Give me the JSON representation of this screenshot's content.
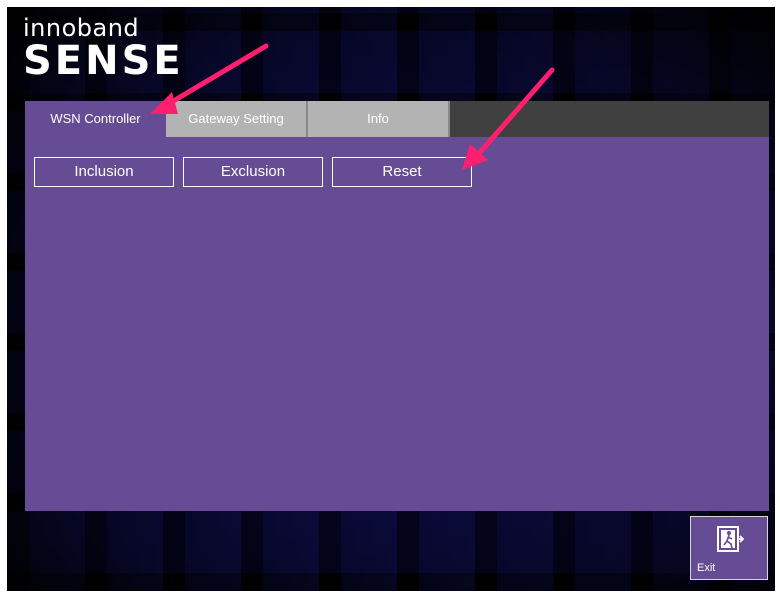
{
  "logo": {
    "top": "innoband",
    "main": "SENSE"
  },
  "tabs": [
    {
      "label": "WSN Controller",
      "state": "active"
    },
    {
      "label": "Gateway Setting",
      "state": "inactive"
    },
    {
      "label": "Info",
      "state": "inactive"
    }
  ],
  "actions": {
    "inclusion": "Inclusion",
    "exclusion": "Exclusion",
    "reset": "Reset"
  },
  "exit": {
    "label": "Exit",
    "icon": "exit-door-icon"
  },
  "colors": {
    "panel": "#654c94",
    "tabstrip": "#404040",
    "inactive_tab": "#b3b3b3",
    "annotation_arrow": "#ff1f6e"
  }
}
